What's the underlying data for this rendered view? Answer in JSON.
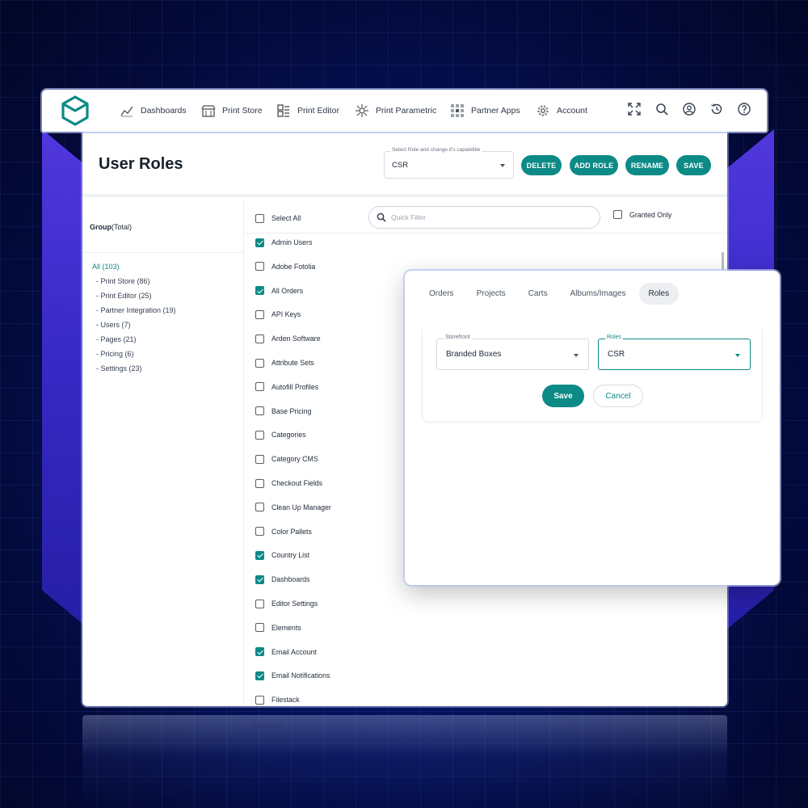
{
  "nav": {
    "items": [
      {
        "label": "Dashboards",
        "icon": "chart-icon"
      },
      {
        "label": "Print Store",
        "icon": "store-icon"
      },
      {
        "label": "Print Editor",
        "icon": "editor-icon"
      },
      {
        "label": "Print Parametric",
        "icon": "parametric-icon"
      },
      {
        "label": "Partner Apps",
        "icon": "apps-grid-icon"
      },
      {
        "label": "Account",
        "icon": "gear-icon"
      }
    ],
    "right_icons": [
      "fullscreen-icon",
      "search-icon",
      "user-icon",
      "history-icon",
      "help-icon"
    ]
  },
  "header": {
    "title": "User Roles",
    "role_select": {
      "label": "Select Role and change it's capabilitie",
      "value": "CSR"
    },
    "buttons": {
      "delete": "DELETE",
      "add_role": "ADD ROLE",
      "rename": "RENAME",
      "save": "SAVE"
    }
  },
  "groups": {
    "title_bold": "Group",
    "title_rest": "(Total)",
    "items": [
      {
        "label": "All (103)",
        "active": true
      },
      {
        "label": "- Print Store (86)"
      },
      {
        "label": "- Print Editor (25)"
      },
      {
        "label": "- Partner Integration (19)"
      },
      {
        "label": "- Users (7)"
      },
      {
        "label": "- Pages (21)"
      },
      {
        "label": "- Pricing (6)"
      },
      {
        "label": "- Settings (23)"
      }
    ]
  },
  "permissions": {
    "select_all": "Select All",
    "quick_filter_placeholder": "Quick Filter",
    "granted_only": "Granted Only",
    "items": [
      {
        "label": "Admin Users",
        "checked": true
      },
      {
        "label": "Adobe Fotolia",
        "checked": false
      },
      {
        "label": "All Orders",
        "checked": true
      },
      {
        "label": "API Keys",
        "checked": false
      },
      {
        "label": "Arden Software",
        "checked": false
      },
      {
        "label": "Attribute Sets",
        "checked": false
      },
      {
        "label": "Autofill Profiles",
        "checked": false
      },
      {
        "label": "Base Pricing",
        "checked": false
      },
      {
        "label": "Categories",
        "checked": false
      },
      {
        "label": "Category CMS",
        "checked": false
      },
      {
        "label": "Checkout Fields",
        "checked": false
      },
      {
        "label": "Clean Up Manager",
        "checked": false
      },
      {
        "label": "Color Pallets",
        "checked": false
      },
      {
        "label": "Country List",
        "checked": true
      },
      {
        "label": "Dashboards",
        "checked": true
      },
      {
        "label": "Editor Settings",
        "checked": false
      },
      {
        "label": "Elements",
        "checked": false
      },
      {
        "label": "Email Account",
        "checked": true
      },
      {
        "label": "Email Notifications",
        "checked": true
      },
      {
        "label": "Filestack",
        "checked": false
      }
    ]
  },
  "card": {
    "tabs": [
      "Orders",
      "Projects",
      "Carts",
      "Albums/Images",
      "Roles"
    ],
    "active_tab": "Roles",
    "storefront": {
      "label": "Storefront",
      "value": "Branded Boxes"
    },
    "roles": {
      "label": "Roles",
      "value": "CSR"
    },
    "save": "Save",
    "cancel": "Cancel"
  },
  "reflection_text": "Filestack",
  "colors": {
    "accent": "#0c8a86",
    "background": "#061565"
  }
}
